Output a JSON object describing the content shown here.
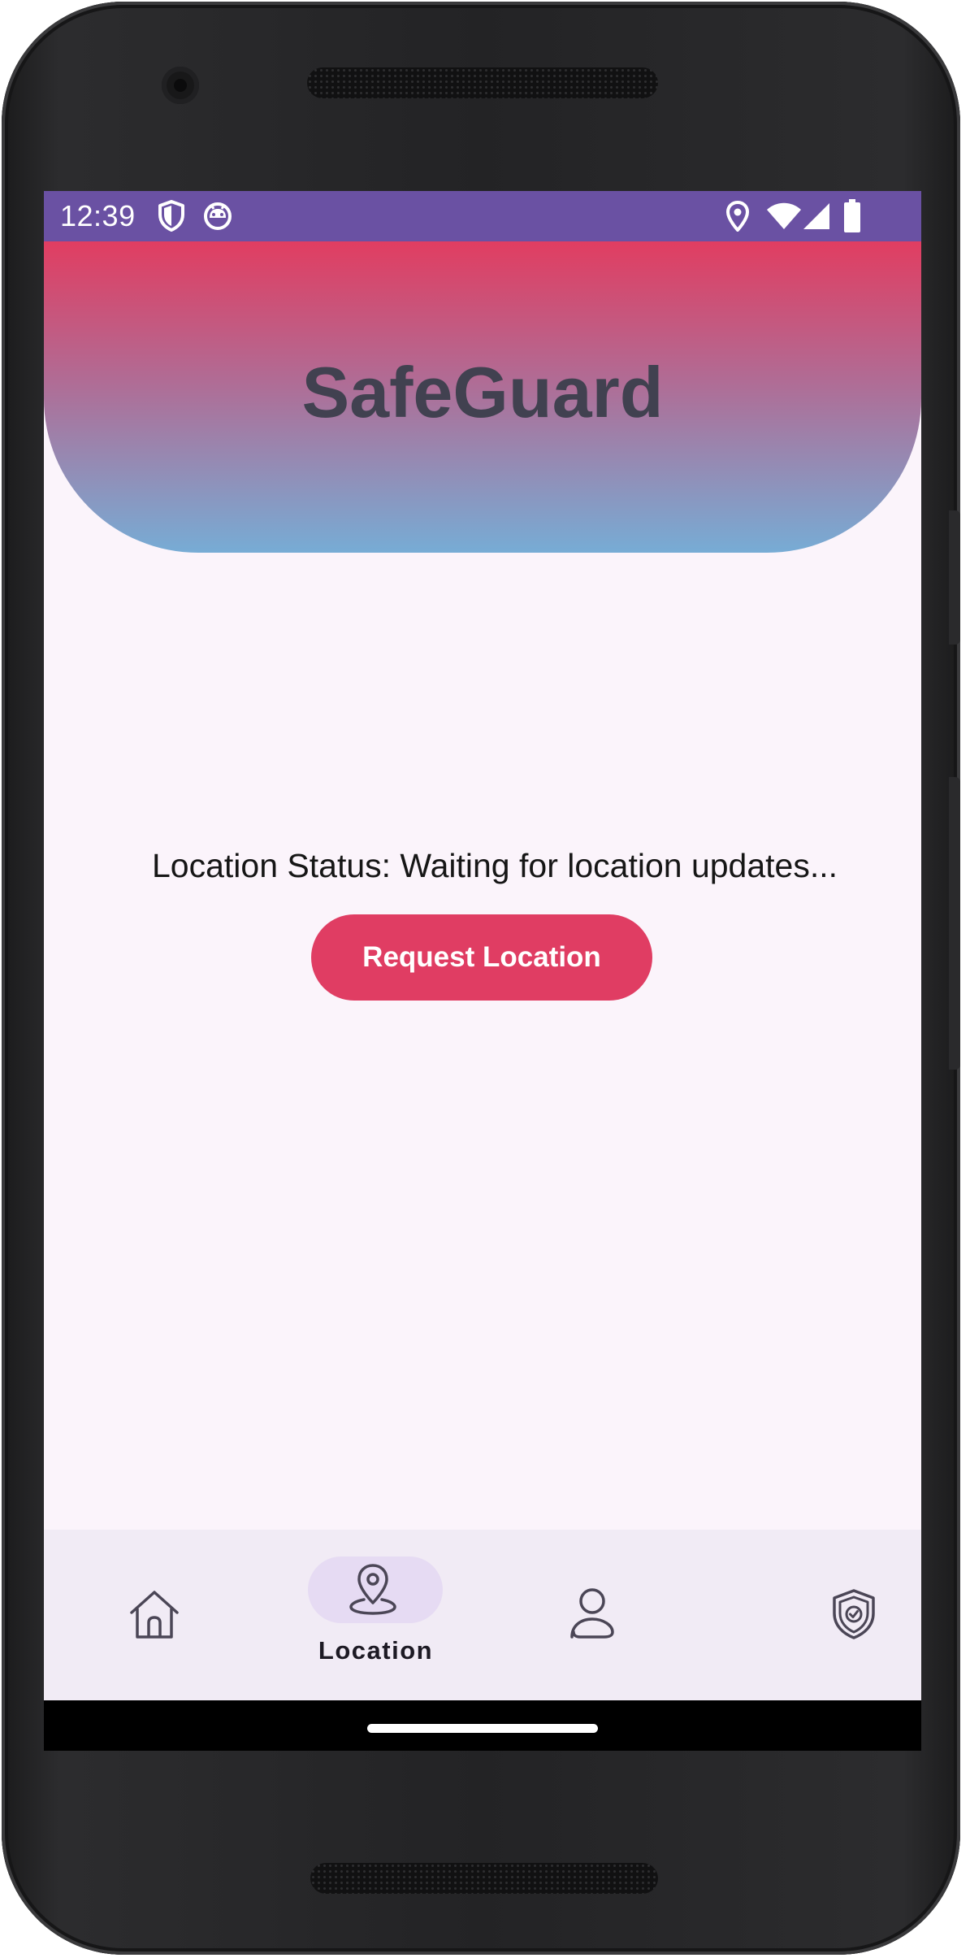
{
  "status_bar": {
    "time": "12:39",
    "background": "#6a51a3",
    "left_icons": [
      "shield-icon",
      "android-robot-icon"
    ],
    "right_icons": [
      "location-pin-icon",
      "wifi-icon",
      "cell-signal-icon",
      "battery-icon"
    ]
  },
  "header": {
    "title": "SafeGuard",
    "gradient": [
      "#e13d61",
      "#b06c95",
      "#77acd5"
    ]
  },
  "main": {
    "location_status": "Location Status: Waiting for location updates...",
    "request_button_label": "Request Location",
    "accent_color": "#e03d63"
  },
  "bottom_nav": {
    "selected_index": 1,
    "items": [
      {
        "icon": "home-icon",
        "label": ""
      },
      {
        "icon": "location-pin-icon",
        "label": "Location"
      },
      {
        "icon": "person-icon",
        "label": ""
      },
      {
        "icon": "shield-check-icon",
        "label": ""
      }
    ]
  }
}
